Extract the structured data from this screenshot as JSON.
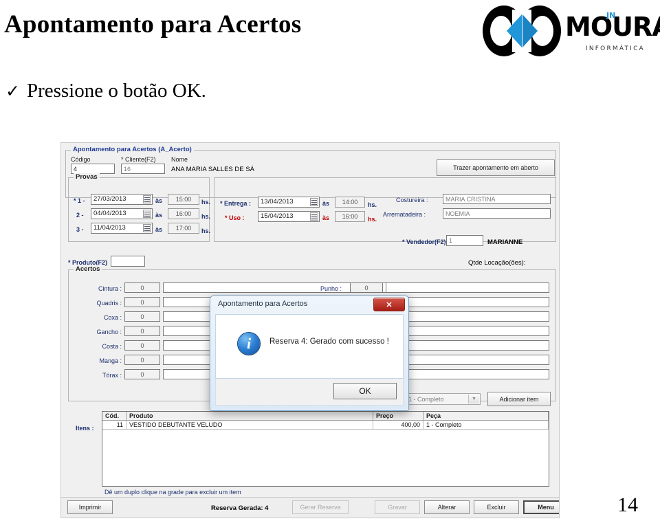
{
  "slide": {
    "title": "Apontamento para Acertos",
    "bullet_mark": "✓",
    "bullet_text": "Pressione o botão OK.",
    "page_number": "14"
  },
  "logo": {
    "wordmark": "MOURA",
    "badge": "JN",
    "tagline": "INFORMÁTICA",
    "accent_color": "#1f93d6"
  },
  "app": {
    "group_title": "Apontamento para Acertos (A_Acerto)",
    "header": {
      "codigo_label": "Código",
      "codigo_value": "4",
      "cliente_label": "* Cliente(F2)",
      "cliente_value": "16",
      "nome_label": "Nome",
      "nome_value": "ANA MARIA SALLES DE SÁ",
      "trazer_button": "Trazer apontamento em aberto",
      "trazer_accesskey": "T"
    },
    "provas": {
      "legend": "Provas",
      "as_label": "às",
      "hs_label": "hs.",
      "rows": [
        {
          "num": "* 1 -",
          "date": "27/03/2013",
          "time": "15:00"
        },
        {
          "num": "2 -",
          "date": "04/04/2013",
          "time": "16:00"
        },
        {
          "num": "3 -",
          "date": "11/04/2013",
          "time": "17:00"
        }
      ]
    },
    "entrega": {
      "entrega_label": "* Entrega :",
      "entrega_date": "13/04/2013",
      "entrega_time": "14:00",
      "uso_label": "* Uso :",
      "uso_date": "15/04/2013",
      "uso_time": "16:00",
      "as_label": "às",
      "hs_label": "hs.",
      "costureira_label": "Costureira :",
      "costureira_value": "MARIA CRISTINA",
      "arrematadeira_label": "Arrematadeira :",
      "arrematadeira_value": "NOEMIA",
      "vendedor_label": "* Vendedor(F2)",
      "vendedor_value": "1",
      "vendedor_name": "MARIANNE"
    },
    "produto": {
      "label": "* Produto(F2)",
      "value": "",
      "qtde_label": "Qtde Locação(ões):"
    },
    "acertos": {
      "legend": "Acertos",
      "punho_label": "Punho :",
      "punho_value": "0",
      "rows": [
        {
          "label": "Cintura :",
          "value": "0",
          "note": ""
        },
        {
          "label": "Quadris :",
          "value": "0",
          "note": ""
        },
        {
          "label": "Coxa :",
          "value": "0",
          "note": ""
        },
        {
          "label": "Gancho :",
          "value": "0",
          "note": ""
        },
        {
          "label": "Costa :",
          "value": "0",
          "note": ""
        },
        {
          "label": "Manga :",
          "value": "0",
          "note": ""
        },
        {
          "label": "Tórax :",
          "value": "0",
          "note": ""
        }
      ],
      "peca_combo": "1 - Completo",
      "adicionar_button": "Adicionar item"
    },
    "itens": {
      "label": "Itens :",
      "columns": [
        "Cód.",
        "Produto",
        "Preço",
        "Peça"
      ],
      "rows": [
        {
          "cod": "11",
          "produto": "VESTIDO DEBUTANTE VELUDO",
          "preco": "400,00",
          "peca": "1 - Completo"
        }
      ],
      "hint": "Dê um duplo clique na grade para excluir um item"
    },
    "footer": {
      "imprimir": "Imprimir",
      "reserva_status": "Reserva Gerada: 4",
      "gerar_reserva": "Gerar Reserva",
      "gravar": "Gravar",
      "alterar": "Alterar",
      "excluir": "Excluir",
      "menu": "Menu"
    }
  },
  "dialog": {
    "title": "Apontamento para Acertos",
    "close_glyph": "✕",
    "icon": "info-icon",
    "message": "Reserva 4: Gerado com sucesso !",
    "ok_label": "OK"
  }
}
